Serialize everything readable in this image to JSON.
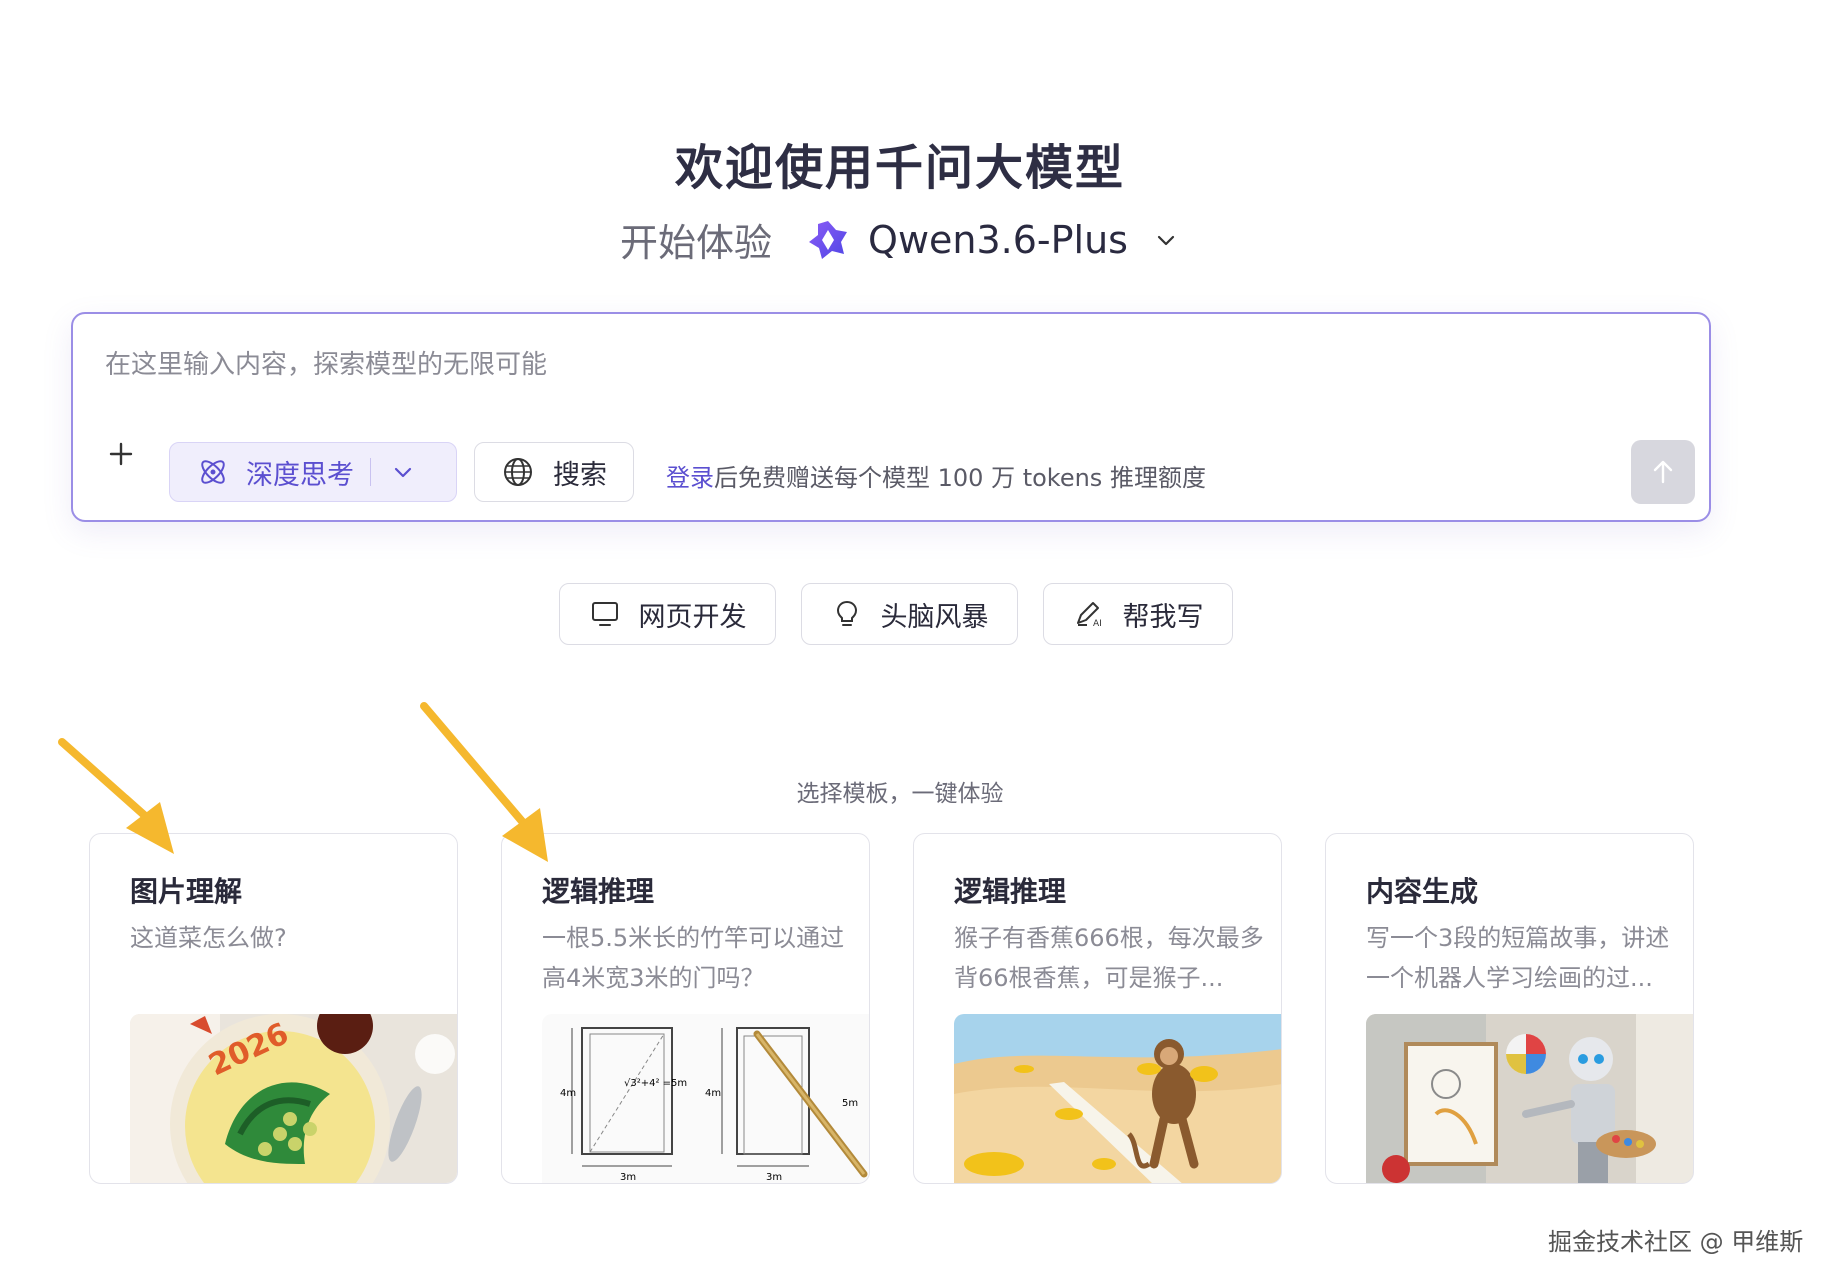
{
  "header": {
    "welcome": "欢迎使用千问大模型",
    "start_label": "开始体验",
    "model_name": "Qwen3.6-Plus"
  },
  "composer": {
    "placeholder": "在这里输入内容，探索模型的无限可能",
    "deep_think_label": "深度思考",
    "search_label": "搜索",
    "promo_link": "登录",
    "promo_text": "后免费赠送每个模型 100 万 tokens 推理额度"
  },
  "quick_actions": [
    {
      "label": "网页开发",
      "icon": "monitor-icon"
    },
    {
      "label": "头脑风暴",
      "icon": "lightbulb-icon"
    },
    {
      "label": "帮我写",
      "icon": "ai-pen-icon"
    }
  ],
  "templates": {
    "title": "选择模板，一键体验",
    "cards": [
      {
        "title": "图片理解",
        "desc": "这道菜怎么做?",
        "image": "dish-image"
      },
      {
        "title": "逻辑推理",
        "desc": "一根5.5米长的竹竿可以通过高4米宽3米的门吗？",
        "image": "door-diagram-image"
      },
      {
        "title": "逻辑推理",
        "desc": "猴子有香蕉666根，每次最多背66根香蕉，可是猴子...",
        "image": "monkey-desert-image"
      },
      {
        "title": "内容生成",
        "desc": "写一个3段的短篇故事，讲述一个机器人学习绘画的过...",
        "image": "robot-painting-image"
      }
    ]
  },
  "image_text": {
    "dish_year": "2026",
    "diagram_h1": "4m",
    "diagram_diag": "√3²+4² =5m",
    "diagram_w1": "3m",
    "diagram_h2": "4m",
    "diagram_pole": "5m",
    "diagram_w2": "3m"
  },
  "watermark": "掘金技术社区 @ 甲维斯",
  "colors": {
    "accent": "#5b4fd0",
    "border_accent": "#9b8ee6",
    "arrow": "#f5b82e"
  }
}
